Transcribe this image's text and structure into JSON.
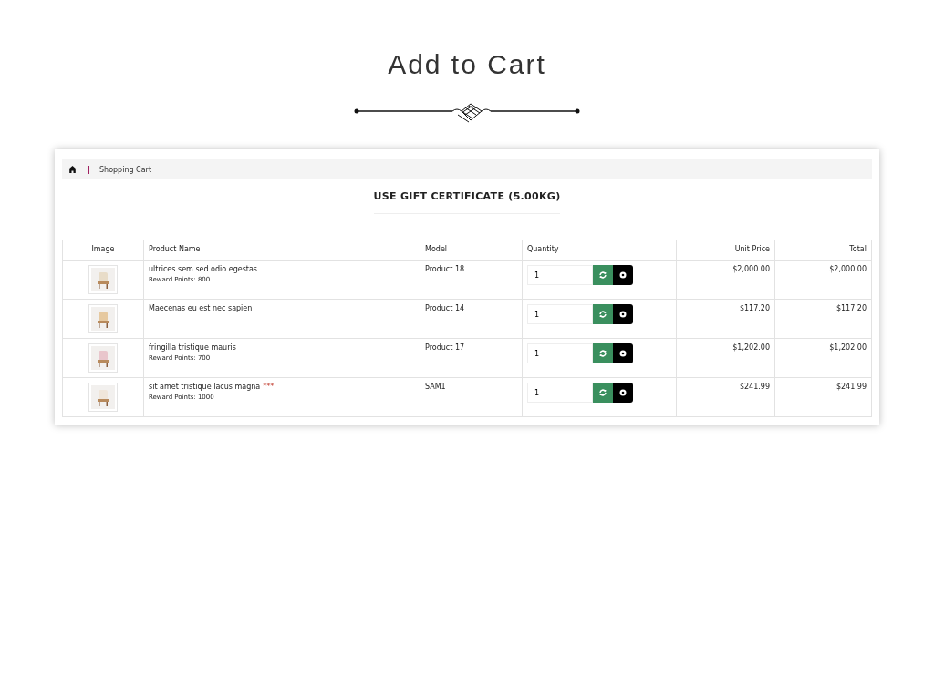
{
  "page_title": "Add to Cart",
  "breadcrumb": [
    {
      "kind": "home"
    },
    {
      "kind": "text",
      "label": "Shopping Cart"
    }
  ],
  "heading": "USE GIFT CERTIFICATE  (5.00KG)",
  "table": {
    "columns": [
      {
        "label": "Image"
      },
      {
        "label": "Product Name"
      },
      {
        "label": "Model"
      },
      {
        "label": "Quantity"
      },
      {
        "label": "Unit Price"
      },
      {
        "label": "Total"
      }
    ],
    "rows": [
      {
        "name": "ultrices sem sed odio egestas",
        "reward": "Reward Points: 800",
        "model": "Product 18",
        "quantity": "1",
        "unit_price": "$2,000.00",
        "total": "$2,000.00"
      },
      {
        "name": "Maecenas eu est nec sapien",
        "model": "Product 14",
        "quantity": "1",
        "unit_price": "$117.20",
        "total": "$117.20"
      },
      {
        "name": "fringilla tristique mauris",
        "reward": "Reward Points: 700",
        "model": "Product 17",
        "quantity": "1",
        "unit_price": "$1,202.00",
        "total": "$1,202.00"
      },
      {
        "name": "sit amet tristique lacus magna",
        "stock_mark": "***",
        "reward": "Reward Points: 1000",
        "model": "SAM1",
        "quantity": "1",
        "unit_price": "$241.99",
        "total": "$241.99"
      }
    ]
  }
}
